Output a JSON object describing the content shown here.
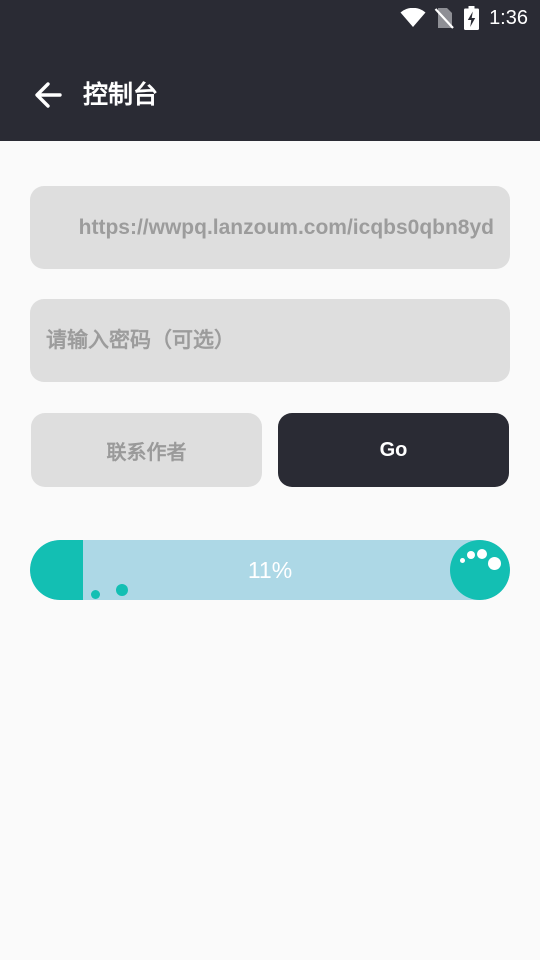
{
  "status_bar": {
    "time": "1:36",
    "icons": [
      "wifi-icon",
      "no-sim-icon",
      "battery-charging-icon"
    ]
  },
  "app_bar": {
    "back_icon": "arrow-left-icon",
    "title": "控制台"
  },
  "form": {
    "url_value": "https://wwpq.lanzoum.com/icqbs0qbn8yd",
    "password_placeholder": "请输入密码（可选）",
    "password_value": ""
  },
  "buttons": {
    "contact_label": "联系作者",
    "go_label": "Go"
  },
  "progress": {
    "label": "11%",
    "fraction": 0.11
  },
  "colors": {
    "header_bg": "#2a2b34",
    "page_bg": "#fafafa",
    "field_bg": "#dedede",
    "progress_track": "#add8e6",
    "progress_accent": "#13bfb3"
  }
}
